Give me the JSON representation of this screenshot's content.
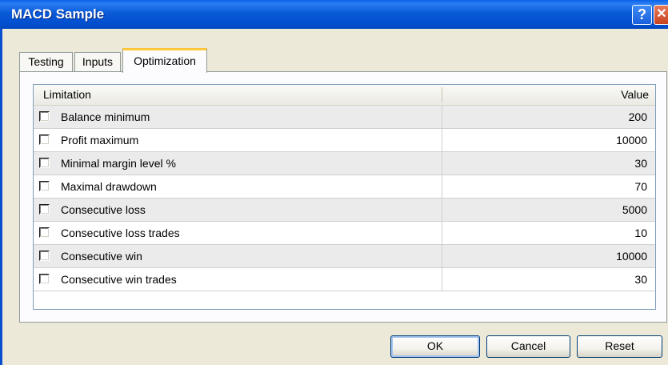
{
  "window": {
    "title": "MACD Sample",
    "help_label": "?",
    "close_label": "✕"
  },
  "tabs": [
    {
      "label": "Testing"
    },
    {
      "label": "Inputs"
    },
    {
      "label": "Optimization"
    }
  ],
  "table": {
    "columns": {
      "limitation": "Limitation",
      "value": "Value"
    },
    "rows": [
      {
        "label": "Balance minimum",
        "value": "200",
        "checked": false
      },
      {
        "label": "Profit maximum",
        "value": "10000",
        "checked": false
      },
      {
        "label": "Minimal margin level %",
        "value": "30",
        "checked": false
      },
      {
        "label": "Maximal drawdown",
        "value": "70",
        "checked": false
      },
      {
        "label": "Consecutive loss",
        "value": "5000",
        "checked": false
      },
      {
        "label": "Consecutive loss trades",
        "value": "10",
        "checked": false
      },
      {
        "label": "Consecutive win",
        "value": "10000",
        "checked": false
      },
      {
        "label": "Consecutive win trades",
        "value": "30",
        "checked": false
      }
    ]
  },
  "buttons": {
    "ok": "OK",
    "cancel": "Cancel",
    "reset": "Reset"
  },
  "colors": {
    "titlebar": "#0a5ad8",
    "active_tab_accent": "#ffc83c",
    "dialog_bg": "#ece9d8"
  }
}
